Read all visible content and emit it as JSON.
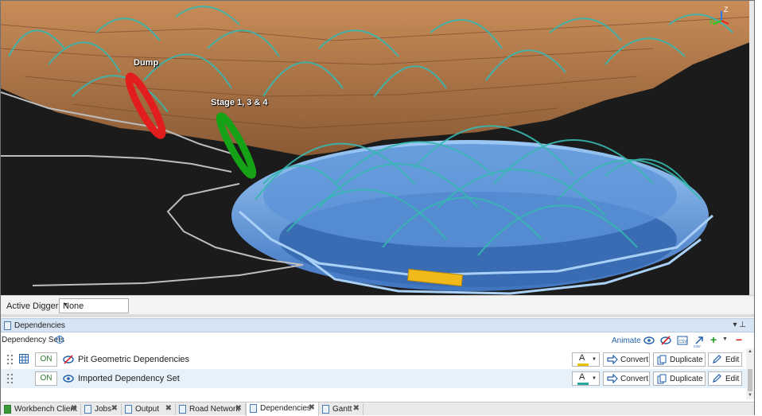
{
  "viewport": {
    "labels": {
      "dump": "Dump",
      "stage": "Stage 1, 3 & 4"
    },
    "axis": {
      "z": "Z",
      "n": "N"
    }
  },
  "digger": {
    "label": "Active Digger",
    "value": "None"
  },
  "panel": {
    "title": "Dependencies",
    "sets_label": "Dependency Sets",
    "animate_label": "Animate",
    "toolbar_icons": [
      "eye-icon",
      "hide-icon",
      "import-csv-icon",
      "export-icon",
      "export-csv-icon",
      "add-icon",
      "dropdown-icon",
      "remove-icon"
    ]
  },
  "rows": [
    {
      "toggle": "ON",
      "icon": "hidden-eye-icon",
      "name": "Pit Geometric Dependencies",
      "color_letter": "A",
      "bar_color": "#e6c200",
      "convert": "Convert",
      "duplicate": "Duplicate",
      "edit": "Edit"
    },
    {
      "toggle": "ON",
      "icon": "eye-icon",
      "name": "Imported Dependency Set",
      "color_letter": "A",
      "bar_color": "#2aa7a0",
      "convert": "Convert",
      "duplicate": "Duplicate",
      "edit": "Edit"
    }
  ],
  "tabs": [
    {
      "label": "Workbench Client",
      "icon": "workbench-icon",
      "active": false
    },
    {
      "label": "Jobs",
      "icon": "panel-icon",
      "active": false
    },
    {
      "label": "Output",
      "icon": "panel-icon",
      "active": false
    },
    {
      "label": "Road Network",
      "icon": "panel-icon",
      "active": false
    },
    {
      "label": "Dependencies",
      "icon": "panel-icon",
      "active": true
    },
    {
      "label": "Gantt",
      "icon": "panel-icon",
      "active": false
    }
  ],
  "colors": {
    "terrain": "#b57a4a",
    "pit": "#6aa6e8",
    "arcs": "#37b7b0",
    "dump_marker": "#e11d1d",
    "stage_marker": "#16a216",
    "digger_block": "#f2b91b"
  }
}
